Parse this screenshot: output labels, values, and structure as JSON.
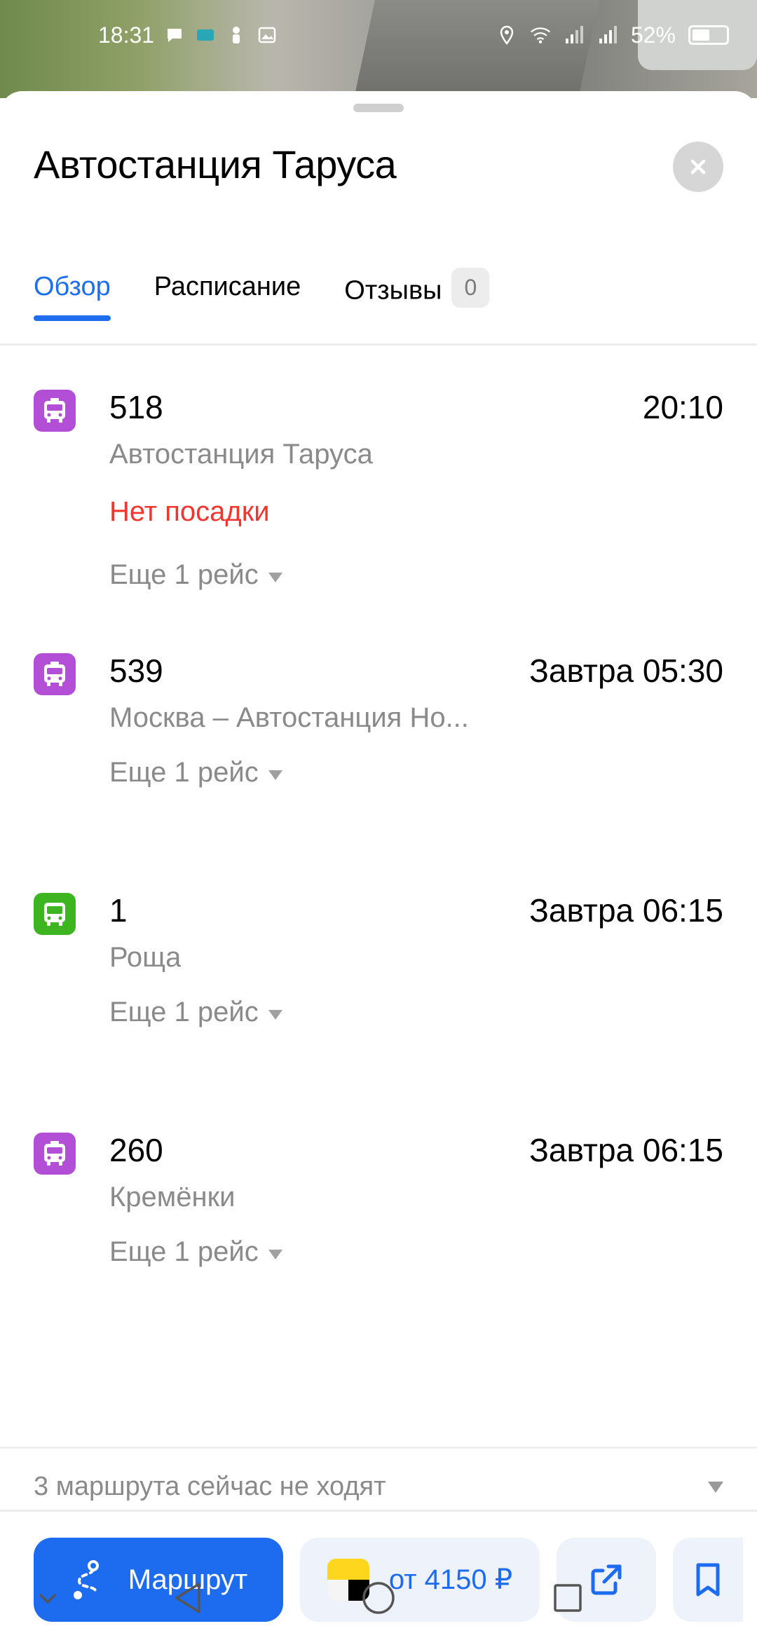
{
  "status_bar": {
    "time": "18:31",
    "battery_percent": "52%",
    "battery_level": 0.52,
    "icons_left": [
      "chat-icon",
      "notification-icon",
      "person-icon",
      "image-icon"
    ],
    "icons_right": [
      "location-icon",
      "wifi-icon",
      "signal-icon",
      "signal-icon",
      "battery-icon"
    ]
  },
  "sheet": {
    "title": "Автостанция Таруса",
    "close_icon": "close-icon"
  },
  "tabs": [
    {
      "label": "Обзор",
      "active": true
    },
    {
      "label": "Расписание",
      "active": false
    },
    {
      "label": "Отзывы",
      "badge": "0",
      "active": false
    }
  ],
  "routes": [
    {
      "number": "518",
      "time": "20:10",
      "destination": "Автостанция Таруса",
      "status": "Нет посадки",
      "more": "Еще 1 рейс",
      "icon": "minibus-icon",
      "color": "#b24fd6"
    },
    {
      "number": "539",
      "time": "Завтра 05:30",
      "destination": "Москва – Автостанция Но...",
      "status": "",
      "more": "Еще 1 рейс",
      "icon": "minibus-icon",
      "color": "#b24fd6"
    },
    {
      "number": "1",
      "time": "Завтра 06:15",
      "destination": "Роща",
      "status": "",
      "more": "Еще 1 рейс",
      "icon": "bus-icon",
      "color": "#3cb521"
    },
    {
      "number": "260",
      "time": "Завтра 06:15",
      "destination": "Кремёнки",
      "status": "",
      "more": "Еще 1 рейс",
      "icon": "minibus-icon",
      "color": "#b24fd6"
    }
  ],
  "inactive": {
    "label": "3 маршрута сейчас не ходят"
  },
  "actions": {
    "route_label": "Маршрут",
    "taxi_label": "от 4150 ₽",
    "share_icon": "share-icon",
    "bookmark_icon": "bookmark-icon"
  },
  "colors": {
    "accent": "#1d6cf0",
    "alert": "#f2362e",
    "minibus": "#b24fd6",
    "bus": "#3cb521"
  },
  "nav_bar": {
    "icons": [
      "chevron-down-icon",
      "back-icon",
      "home-icon",
      "recents-icon"
    ]
  }
}
